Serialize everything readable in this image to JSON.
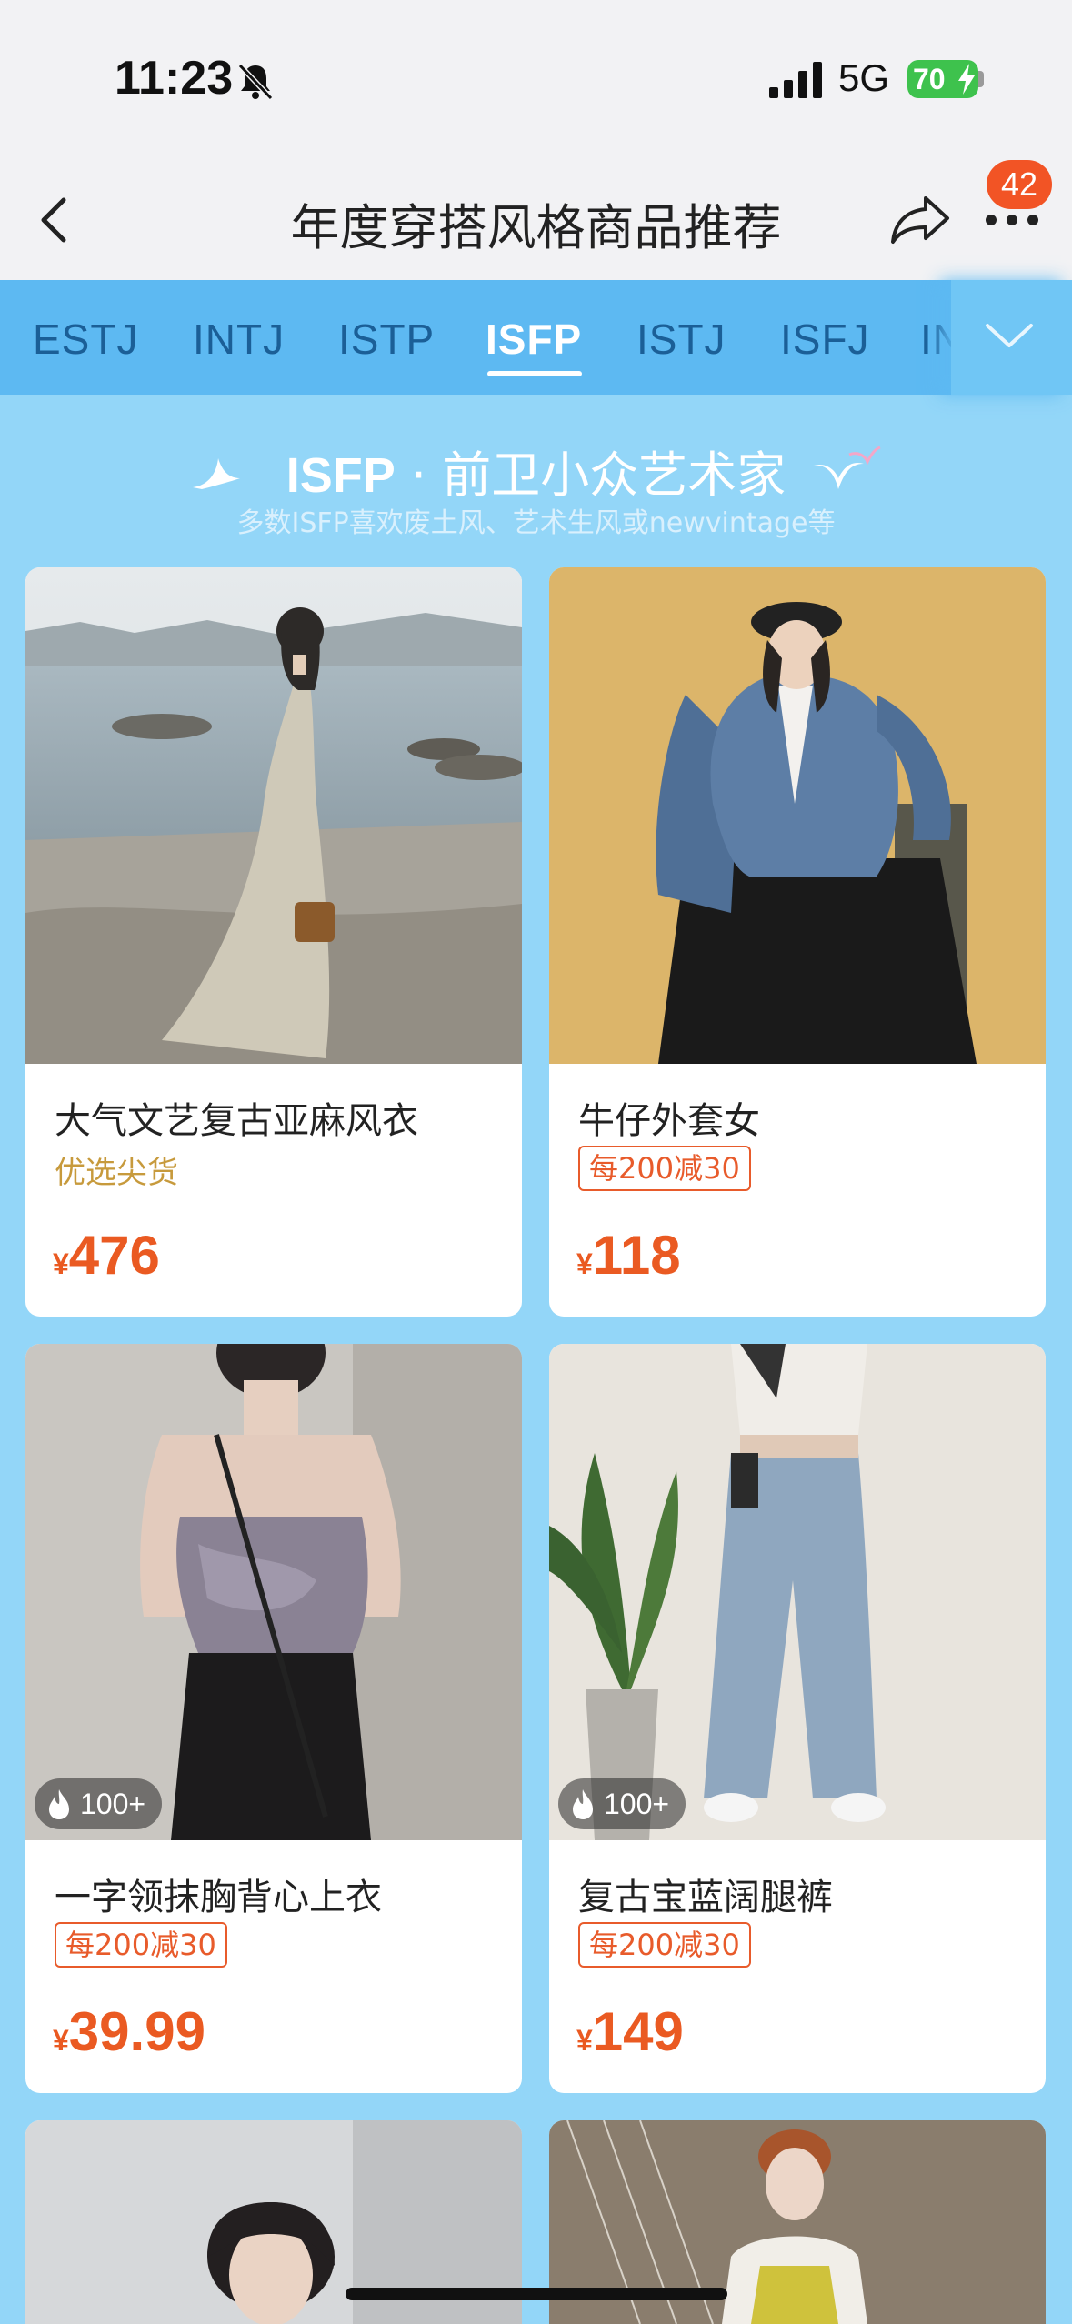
{
  "status_bar": {
    "time": "11:23",
    "network": "5G",
    "battery": "70"
  },
  "nav": {
    "title": "年度穿搭风格商品推荐",
    "badge_count": "42"
  },
  "tabs": [
    "ESTJ",
    "INTJ",
    "ISTP",
    "ISFP",
    "ISTJ",
    "ISFJ",
    "IN"
  ],
  "active_tab": "ISFP",
  "banner": {
    "mbti": "ISFP",
    "separator": "·",
    "title": "前卫小众艺术家",
    "subtitle": "多数ISFP喜欢废土风、艺术生风或newvintage等"
  },
  "products": [
    {
      "name": "大气文艺复古亚麻风衣",
      "tag": "优选尖货",
      "coupon": "",
      "currency": "¥",
      "price": "476",
      "hot": ""
    },
    {
      "name": "牛仔外套女",
      "tag": "",
      "coupon": "每200减30",
      "currency": "¥",
      "price": "118",
      "hot": ""
    },
    {
      "name": "一字领抹胸背心上衣",
      "tag": "",
      "coupon": "每200减30",
      "currency": "¥",
      "price": "39.99",
      "hot": "100+"
    },
    {
      "name": "复古宝蓝阔腿裤",
      "tag": "",
      "coupon": "每200减30",
      "currency": "¥",
      "price": "149",
      "hot": "100+"
    }
  ],
  "colors": {
    "accent_price": "#ea5a22",
    "tab_active": "#ffffff",
    "background": "#93d6f8"
  }
}
